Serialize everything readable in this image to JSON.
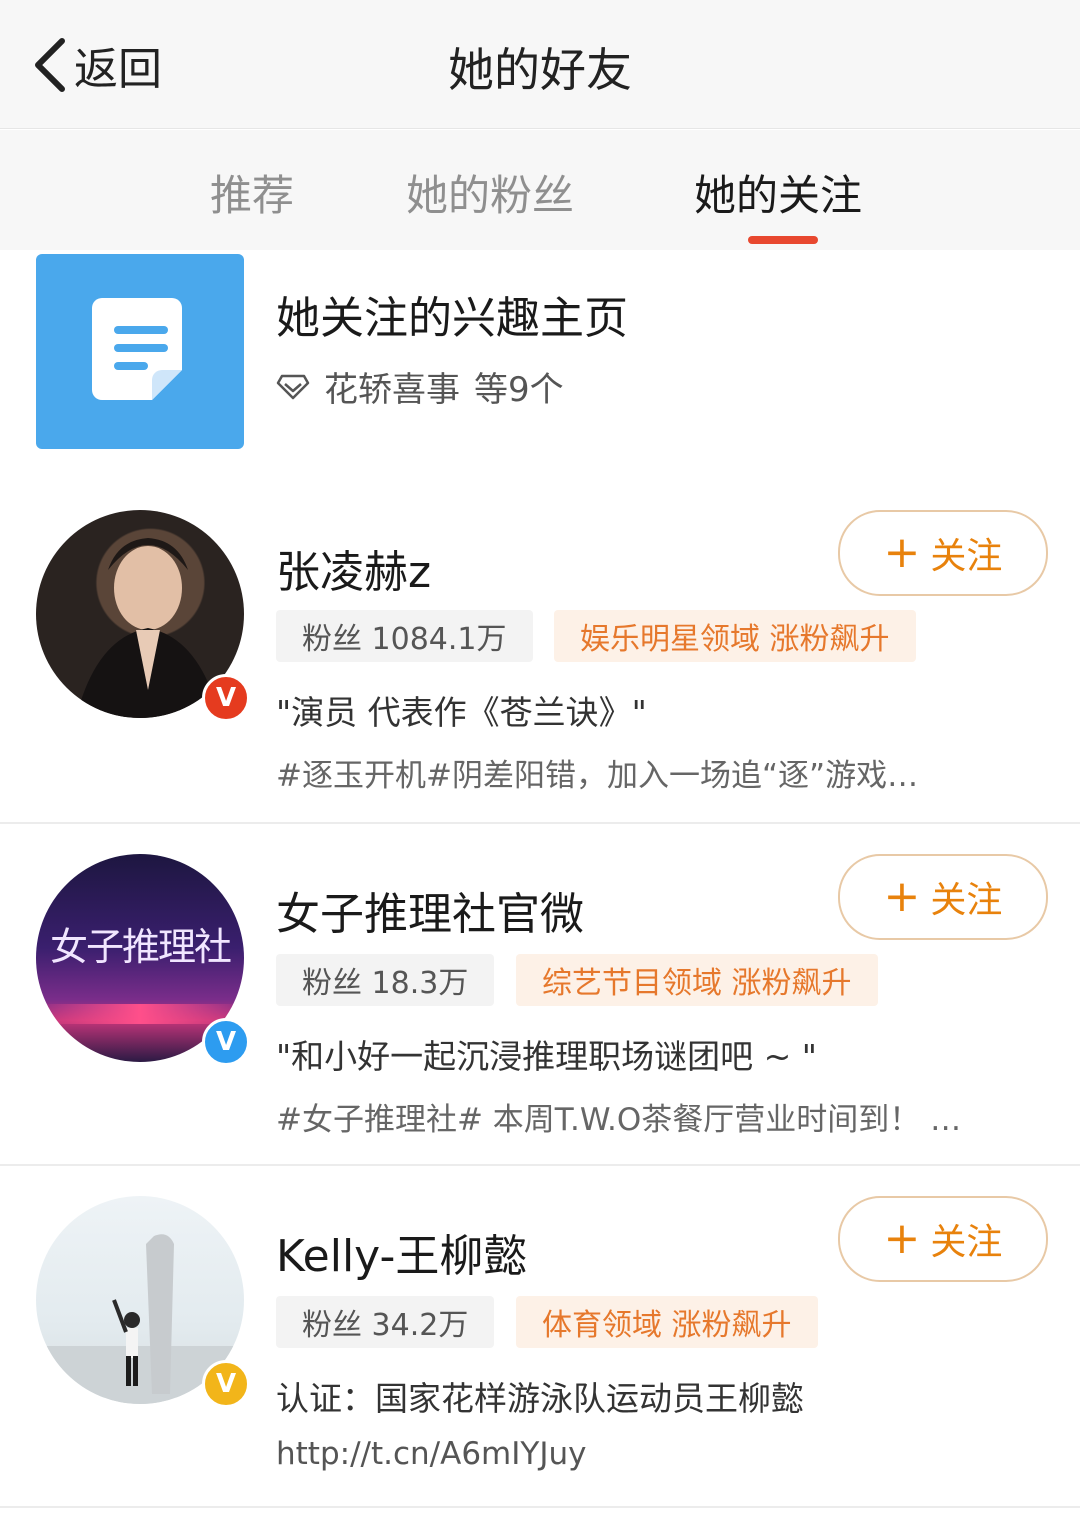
{
  "header": {
    "back_label": "返回",
    "title": "她的好友"
  },
  "tabs": [
    {
      "label": "推荐",
      "active": false
    },
    {
      "label": "她的粉丝",
      "active": false
    },
    {
      "label": "她的关注",
      "active": true
    }
  ],
  "colors": {
    "accent": "#e8482f",
    "follow": "#e8820c",
    "domain_text": "#e6782c",
    "tile_blue": "#4aa8ec"
  },
  "interest": {
    "title": "她关注的兴趣主页",
    "tag": "花轿喜事",
    "count": "等9个",
    "icon": "document-icon"
  },
  "users": [
    {
      "name": "张凌赫z",
      "follow_label": "关注",
      "fans": "粉丝 1084.1万",
      "domain": "娱乐明星领域 涨粉飙升",
      "desc": "\"演员 代表作《苍兰诀》\"",
      "post": "#逐玉开机#阴差阳错，加入一场追“逐”游戏…",
      "badge": "V",
      "badge_color": "#e53b1f"
    },
    {
      "name": "女子推理社官微",
      "follow_label": "关注",
      "fans": "粉丝 18.3万",
      "domain": "综艺节目领域 涨粉飙升",
      "desc": "\"和小好一起沉浸推理职场谜团吧 ~ \"",
      "post": "#女子推理社# 本周T.W.O茶餐厅营业时间到！ …",
      "avatar_text": "女子推理社",
      "badge": "V",
      "badge_color": "#2d9cf0"
    },
    {
      "name": "Kelly-王柳懿",
      "follow_label": "关注",
      "fans": "粉丝 34.2万",
      "domain": "体育领域 涨粉飙升",
      "desc": "认证：国家花样游泳队运动员王柳懿",
      "post": "http://t.cn/A6mIYJuy",
      "badge": "V",
      "badge_color": "#f2b51a"
    }
  ]
}
